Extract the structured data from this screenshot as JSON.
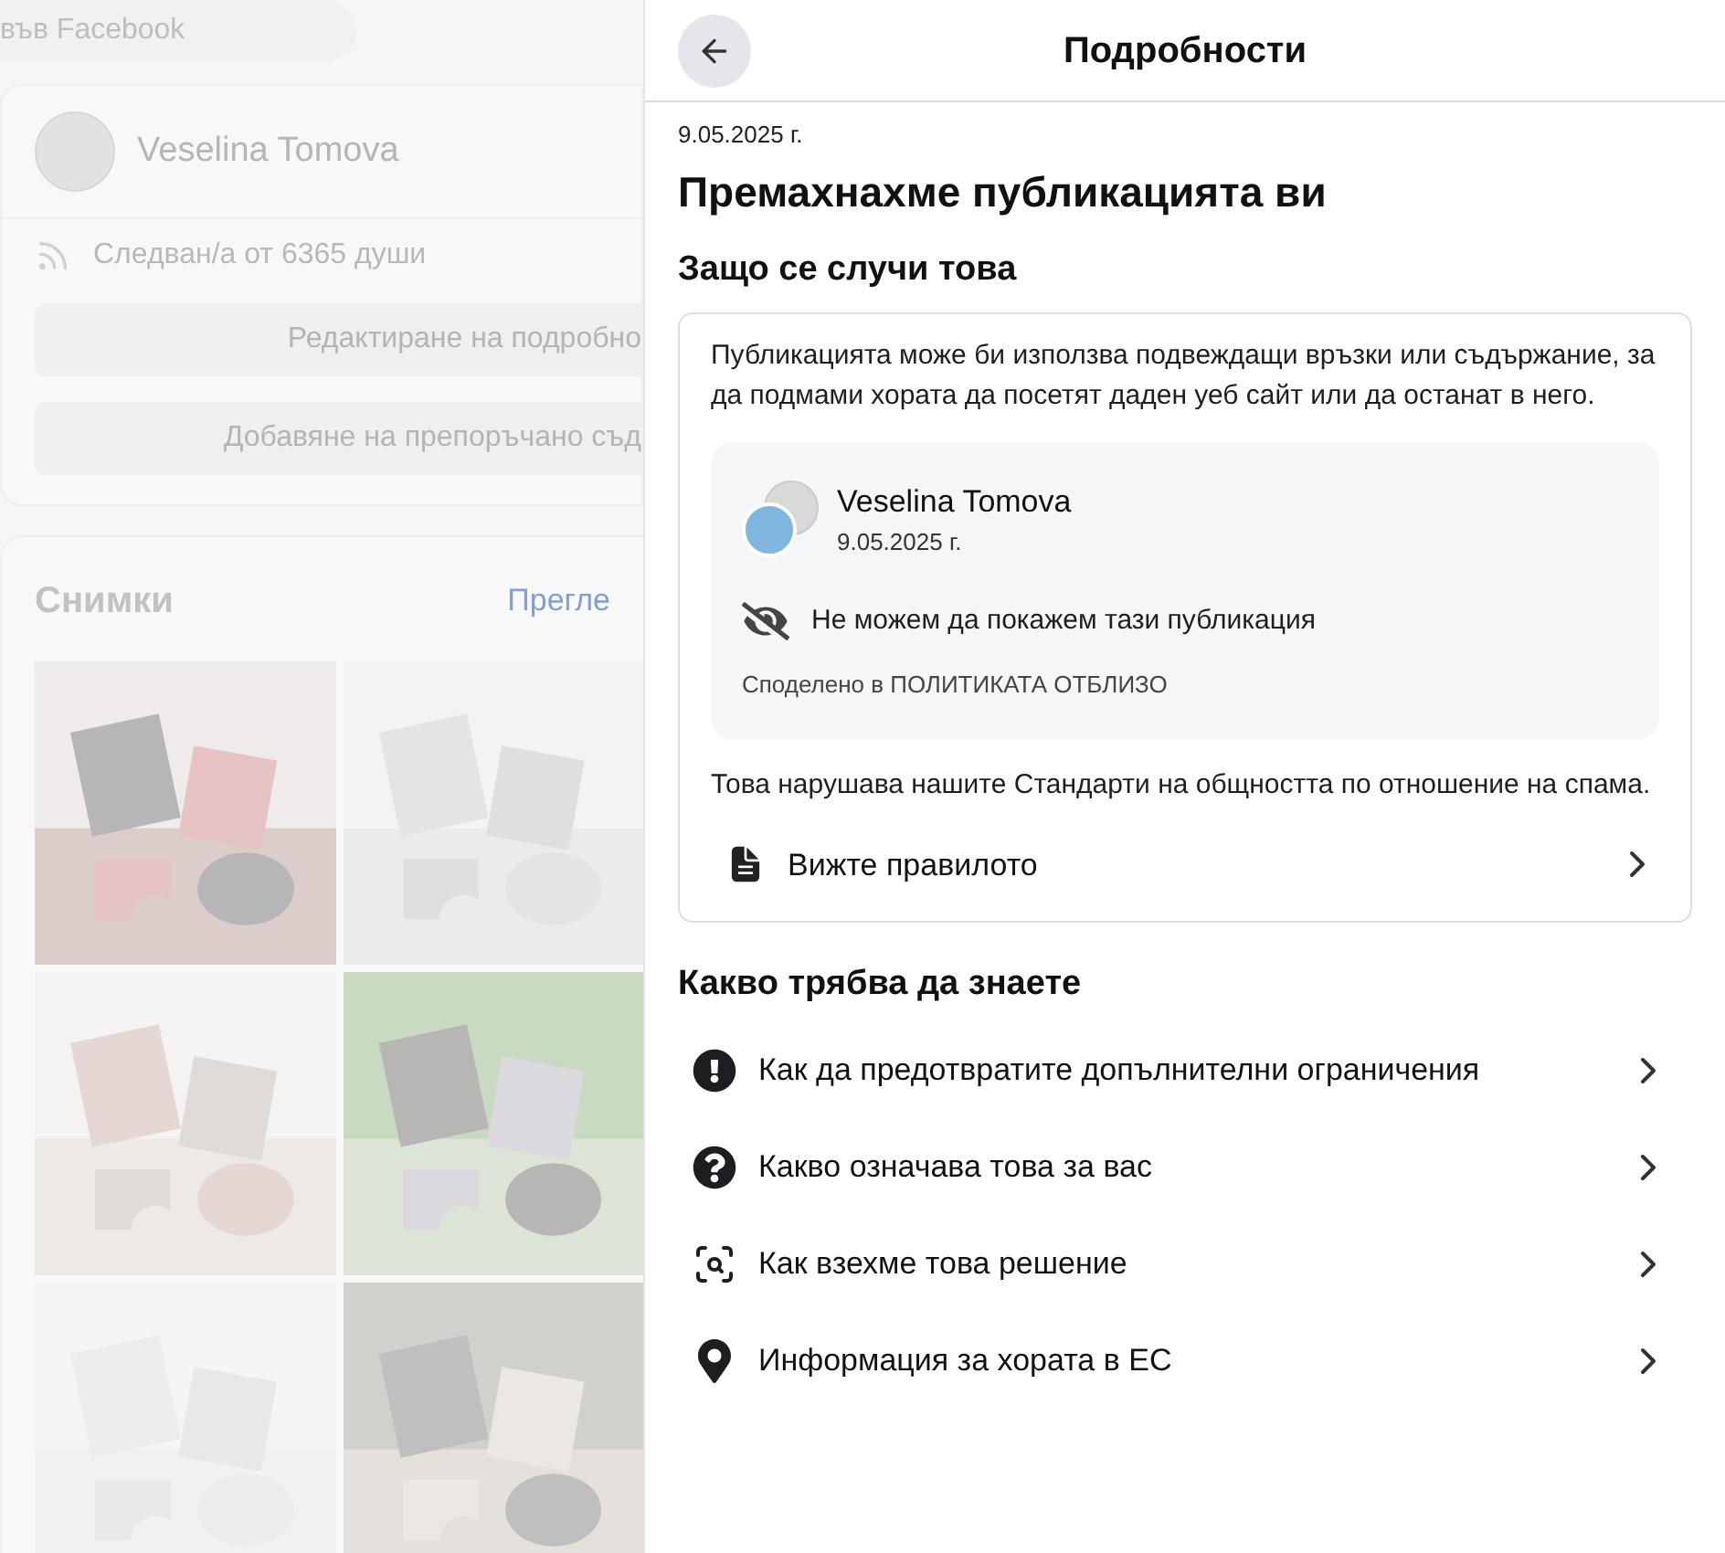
{
  "background_profile": {
    "search": {
      "placeholder": "във Facebook"
    },
    "profile_name": "Veselina Tomova",
    "followers": "Следван/а от 6365 души",
    "buttons": [
      "Редактиране на подробно",
      "Добавяне на препоръчано съд"
    ],
    "photos": {
      "title": "Снимки",
      "link": "Прегле"
    }
  },
  "details_panel": {
    "title": "Подробности",
    "date": "9.05.2025 г.",
    "heading": "Премахнахме публикацията ви",
    "why_heading": "Защо се случи това",
    "why_text": "Публикацията може би използва подвеждащи връзки или съдържание, за да подмами хората да посетят даден уеб сайт или да останат в него.",
    "post": {
      "author": "Veselina Tomova",
      "date": "9.05.2025 г.",
      "hidden_notice": "Не можем да покажем тази публикация",
      "shared_in": "Споделено в ПОЛИТИКАТА ОТБЛИЗО"
    },
    "violation_text": "Това нарушава нашите Стандарти на общността по отношение на спама.",
    "rule_link": "Вижте правилото",
    "know_heading": "Какво трябва да знаете",
    "know_items": [
      {
        "label": "Как да предотвратите допълнителни ограничения"
      },
      {
        "label": "Какво означава това за вас"
      },
      {
        "label": "Как взехме това решение"
      },
      {
        "label": "Информация за хората в ЕС"
      }
    ]
  }
}
